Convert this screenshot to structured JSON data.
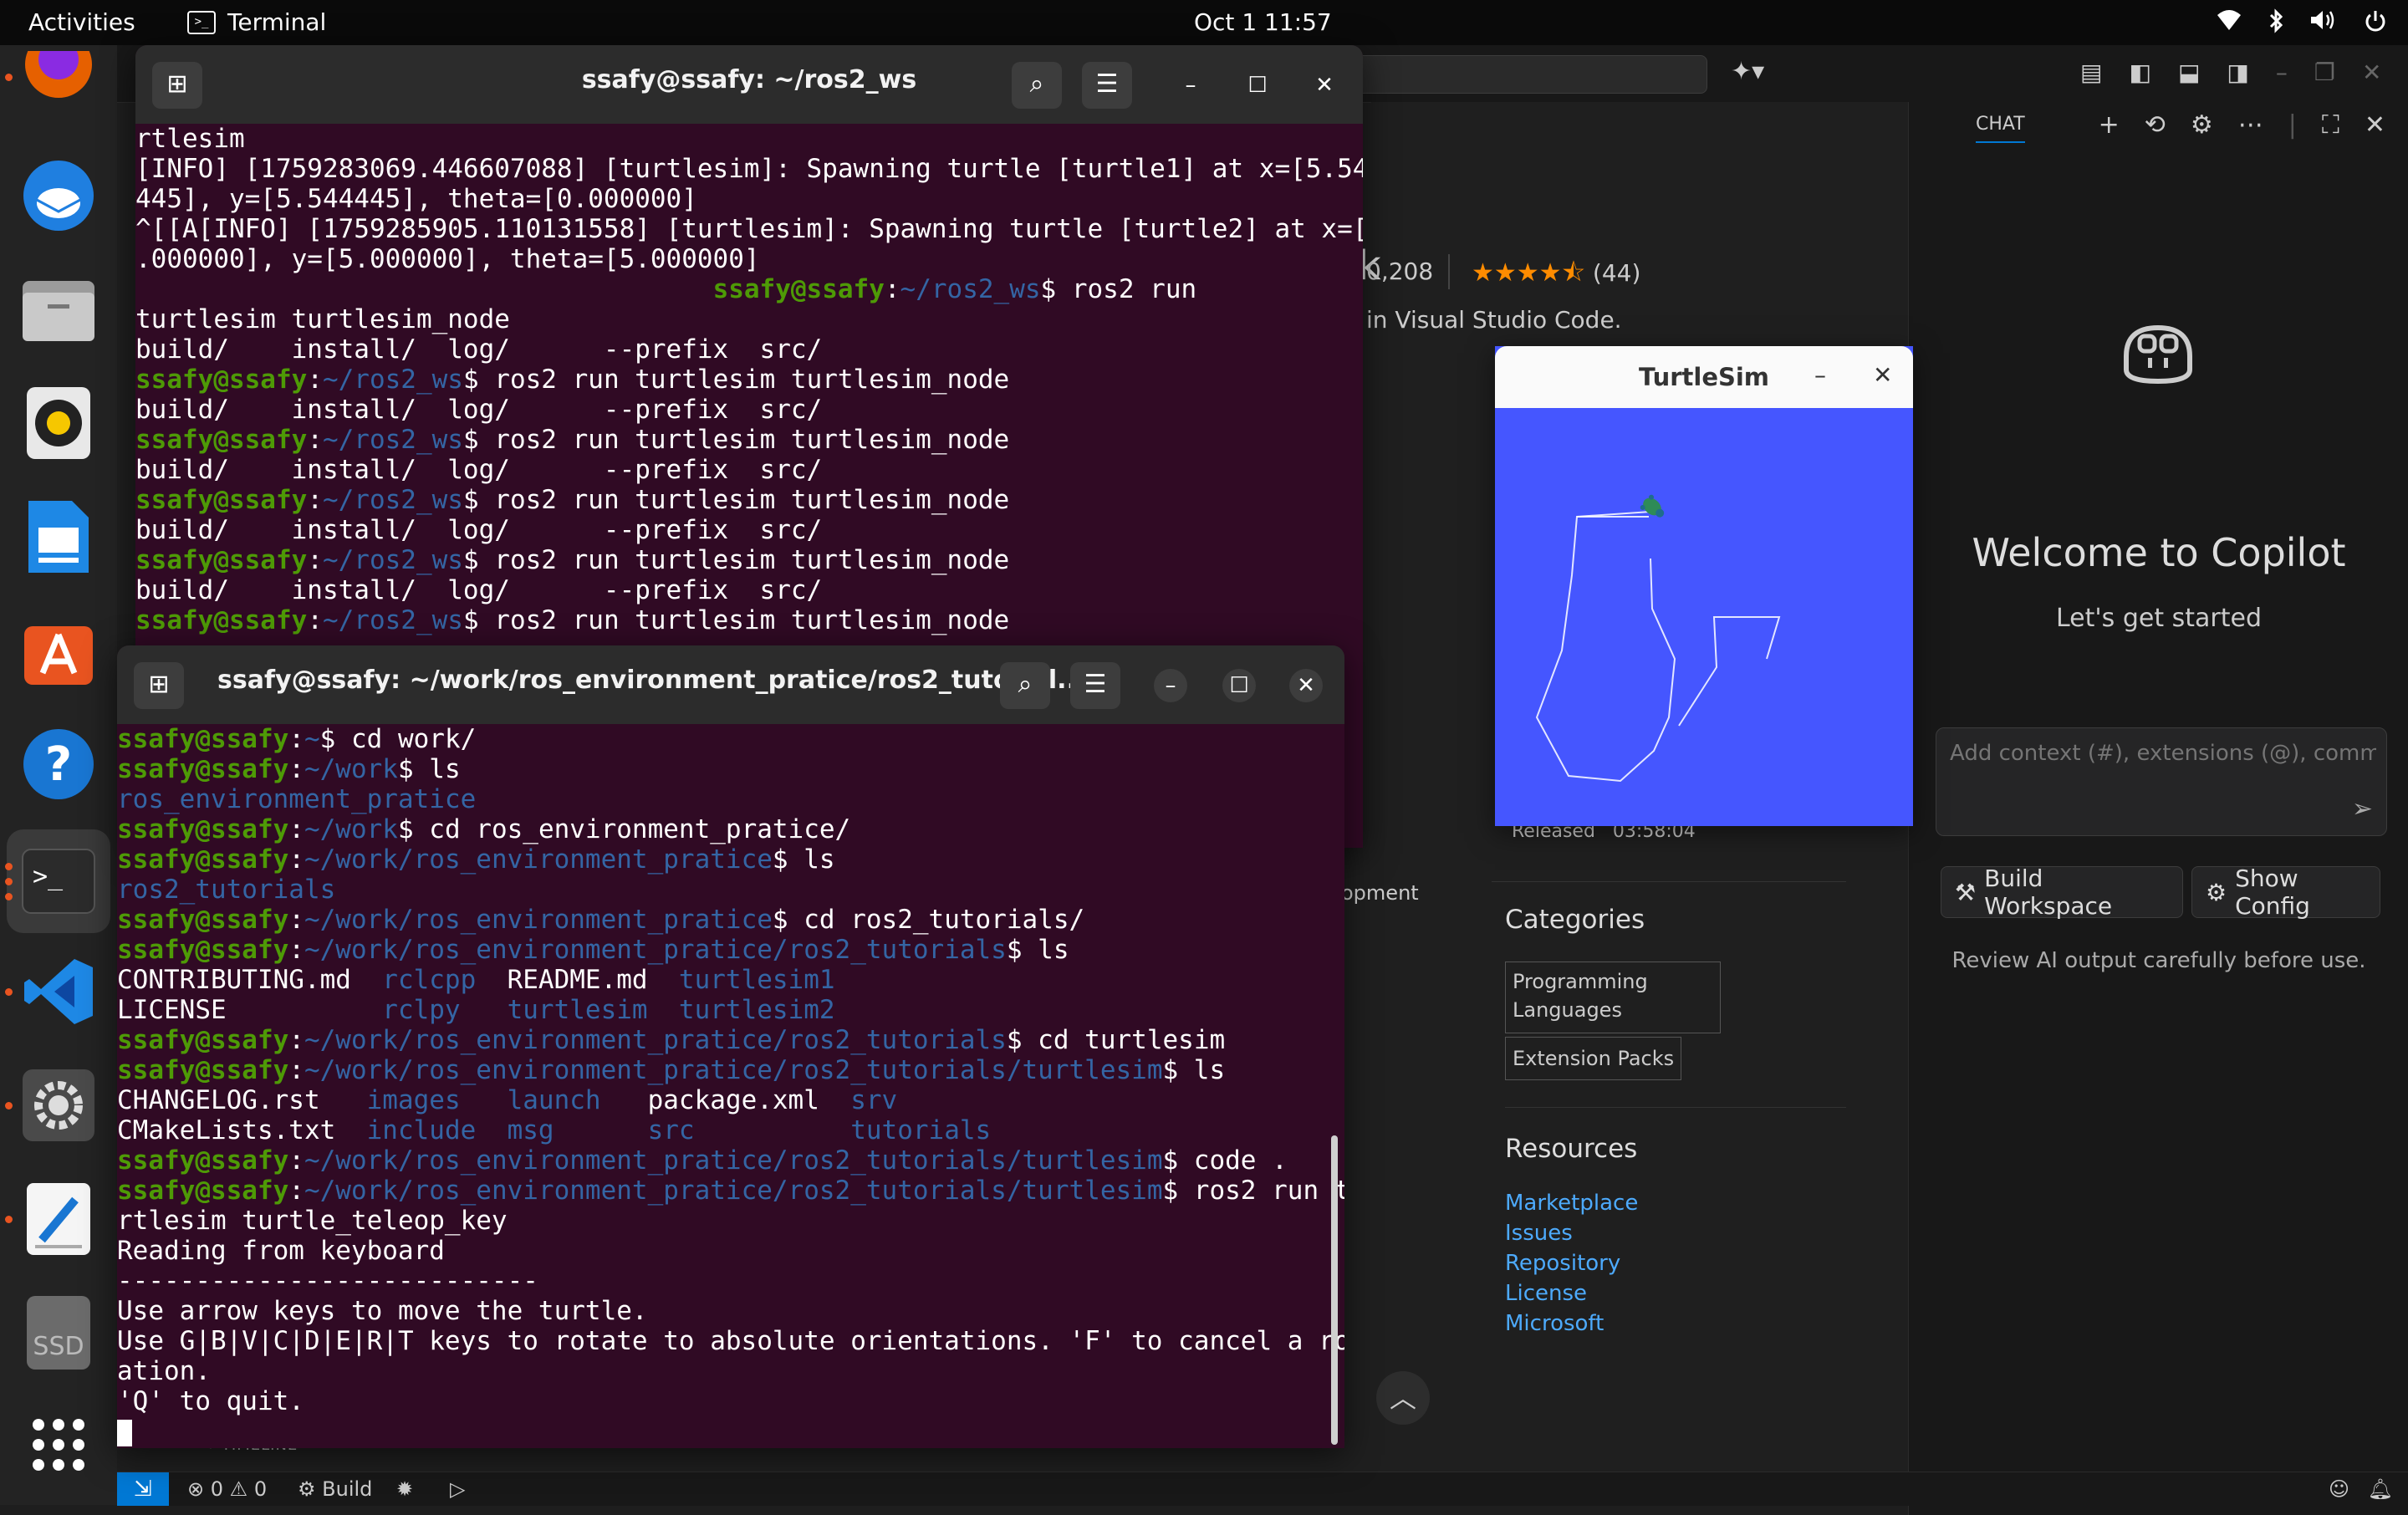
{
  "topbar": {
    "activities": "Activities",
    "app_name": "Terminal",
    "clock": "Oct 1  11:57"
  },
  "vscode": {
    "install_count": "0,208",
    "rating_count": "(44)",
    "description": "in Visual Studio Code.",
    "released_label": "Released",
    "released_time": "03:58:04",
    "development_fragment": "opment",
    "categories_title": "Categories",
    "categories": [
      "Programming Languages",
      "Extension Packs"
    ],
    "resources_title": "Resources",
    "resources": [
      "Marketplace",
      "Issues",
      "Repository",
      "License",
      "Microsoft"
    ],
    "timeline": "TIMELINE",
    "status": {
      "problems": "0",
      "warnings": "0",
      "build": "Build"
    }
  },
  "chat": {
    "tab": "CHAT",
    "welcome": "Welcome to Copilot",
    "subtitle": "Let's get started",
    "input_placeholder": "Add context (#), extensions (@), commands",
    "build_workspace": "Build Workspace",
    "show_config": "Show Config",
    "review": "Review AI output carefully before use."
  },
  "turtlesim": {
    "title": "TurtleSim"
  },
  "terminal1": {
    "title": "ssafy@ssafy: ~/ros2_ws",
    "lines": [
      [
        [
          "t",
          "rtlesim"
        ]
      ],
      [
        [
          "t",
          "[INFO] [1759283069.446607088] [turtlesim]: Spawning turtle [turtle1] at x=[5.544"
        ]
      ],
      [
        [
          "t",
          "445], y=[5.544445], theta=[0.000000]"
        ]
      ],
      [
        [
          "t",
          "^[[A[INFO] [1759285905.110131558] [turtlesim]: Spawning turtle [turtle2] at x=[5"
        ]
      ],
      [
        [
          "t",
          ".000000], y=[5.000000], theta=[5.000000]"
        ]
      ],
      [
        [
          "t",
          "                                     "
        ],
        [
          "u",
          "ssafy@ssafy"
        ],
        [
          "t",
          ":"
        ],
        [
          "p",
          "~/ros2_ws"
        ],
        [
          "t",
          "$ ros2 run"
        ]
      ],
      [
        [
          "t",
          "turtlesim turtlesim_node"
        ]
      ],
      [
        [
          "t",
          "build/    install/  log/      --prefix  src/"
        ]
      ],
      [
        [
          "u",
          "ssafy@ssafy"
        ],
        [
          "t",
          ":"
        ],
        [
          "p",
          "~/ros2_ws"
        ],
        [
          "t",
          "$ ros2 run turtlesim turtlesim_node"
        ]
      ],
      [
        [
          "t",
          "build/    install/  log/      --prefix  src/"
        ]
      ],
      [
        [
          "u",
          "ssafy@ssafy"
        ],
        [
          "t",
          ":"
        ],
        [
          "p",
          "~/ros2_ws"
        ],
        [
          "t",
          "$ ros2 run turtlesim turtlesim_node"
        ]
      ],
      [
        [
          "t",
          "build/    install/  log/      --prefix  src/"
        ]
      ],
      [
        [
          "u",
          "ssafy@ssafy"
        ],
        [
          "t",
          ":"
        ],
        [
          "p",
          "~/ros2_ws"
        ],
        [
          "t",
          "$ ros2 run turtlesim turtlesim_node"
        ]
      ],
      [
        [
          "t",
          "build/    install/  log/      --prefix  src/"
        ]
      ],
      [
        [
          "u",
          "ssafy@ssafy"
        ],
        [
          "t",
          ":"
        ],
        [
          "p",
          "~/ros2_ws"
        ],
        [
          "t",
          "$ ros2 run turtlesim turtlesim_node"
        ]
      ],
      [
        [
          "t",
          "build/    install/  log/      --prefix  src/"
        ]
      ],
      [
        [
          "u",
          "ssafy@ssafy"
        ],
        [
          "t",
          ":"
        ],
        [
          "p",
          "~/ros2_ws"
        ],
        [
          "t",
          "$ ros2 run turtlesim turtlesim_node"
        ]
      ]
    ]
  },
  "terminal2": {
    "title": "ssafy@ssafy: ~/work/ros_environment_pratice/ros2_tutorial...",
    "lines": [
      [
        [
          "u",
          "ssafy@ssafy"
        ],
        [
          "t",
          ":"
        ],
        [
          "p",
          "~"
        ],
        [
          "t",
          "$ cd work/"
        ]
      ],
      [
        [
          "u",
          "ssafy@ssafy"
        ],
        [
          "t",
          ":"
        ],
        [
          "p",
          "~/work"
        ],
        [
          "t",
          "$ ls"
        ]
      ],
      [
        [
          "d",
          "ros_environment_pratice"
        ]
      ],
      [
        [
          "u",
          "ssafy@ssafy"
        ],
        [
          "t",
          ":"
        ],
        [
          "p",
          "~/work"
        ],
        [
          "t",
          "$ cd ros_environment_pratice/"
        ]
      ],
      [
        [
          "u",
          "ssafy@ssafy"
        ],
        [
          "t",
          ":"
        ],
        [
          "p",
          "~/work/ros_environment_pratice"
        ],
        [
          "t",
          "$ ls"
        ]
      ],
      [
        [
          "d",
          "ros2_tutorials"
        ]
      ],
      [
        [
          "u",
          "ssafy@ssafy"
        ],
        [
          "t",
          ":"
        ],
        [
          "p",
          "~/work/ros_environment_pratice"
        ],
        [
          "t",
          "$ cd ros2_tutorials/"
        ]
      ],
      [
        [
          "u",
          "ssafy@ssafy"
        ],
        [
          "t",
          ":"
        ],
        [
          "p",
          "~/work/ros_environment_pratice/ros2_tutorials"
        ],
        [
          "t",
          "$ ls"
        ]
      ],
      [
        [
          "t",
          "CONTRIBUTING.md  "
        ],
        [
          "d",
          "rclcpp"
        ],
        [
          "t",
          "  README.md  "
        ],
        [
          "d",
          "turtlesim1"
        ]
      ],
      [
        [
          "t",
          "LICENSE          "
        ],
        [
          "d",
          "rclpy"
        ],
        [
          "t",
          "   "
        ],
        [
          "d",
          "turtlesim"
        ],
        [
          "t",
          "  "
        ],
        [
          "d",
          "turtlesim2"
        ]
      ],
      [
        [
          "u",
          "ssafy@ssafy"
        ],
        [
          "t",
          ":"
        ],
        [
          "p",
          "~/work/ros_environment_pratice/ros2_tutorials"
        ],
        [
          "t",
          "$ cd turtlesim"
        ]
      ],
      [
        [
          "u",
          "ssafy@ssafy"
        ],
        [
          "t",
          ":"
        ],
        [
          "p",
          "~/work/ros_environment_pratice/ros2_tutorials/turtlesim"
        ],
        [
          "t",
          "$ ls"
        ]
      ],
      [
        [
          "t",
          "CHANGELOG.rst   "
        ],
        [
          "d",
          "images"
        ],
        [
          "t",
          "   "
        ],
        [
          "d",
          "launch"
        ],
        [
          "t",
          "   package.xml  "
        ],
        [
          "d",
          "srv"
        ]
      ],
      [
        [
          "t",
          "CMakeLists.txt  "
        ],
        [
          "d",
          "include"
        ],
        [
          "t",
          "  "
        ],
        [
          "d",
          "msg"
        ],
        [
          "t",
          "      "
        ],
        [
          "d",
          "src"
        ],
        [
          "t",
          "          "
        ],
        [
          "d",
          "tutorials"
        ]
      ],
      [
        [
          "u",
          "ssafy@ssafy"
        ],
        [
          "t",
          ":"
        ],
        [
          "p",
          "~/work/ros_environment_pratice/ros2_tutorials/turtlesim"
        ],
        [
          "t",
          "$ code ."
        ]
      ],
      [
        [
          "u",
          "ssafy@ssafy"
        ],
        [
          "t",
          ":"
        ],
        [
          "p",
          "~/work/ros_environment_pratice/ros2_tutorials/turtlesim"
        ],
        [
          "t",
          "$ ros2 run tu"
        ]
      ],
      [
        [
          "t",
          "rtlesim turtle_teleop_key"
        ]
      ],
      [
        [
          "t",
          "Reading from keyboard"
        ]
      ],
      [
        [
          "t",
          "---------------------------"
        ]
      ],
      [
        [
          "t",
          "Use arrow keys to move the turtle."
        ]
      ],
      [
        [
          "t",
          "Use G|B|V|C|D|E|R|T keys to rotate to absolute orientations. 'F' to cancel a rot"
        ]
      ],
      [
        [
          "t",
          "ation."
        ]
      ],
      [
        [
          "t",
          "'Q' to quit."
        ]
      ]
    ]
  }
}
